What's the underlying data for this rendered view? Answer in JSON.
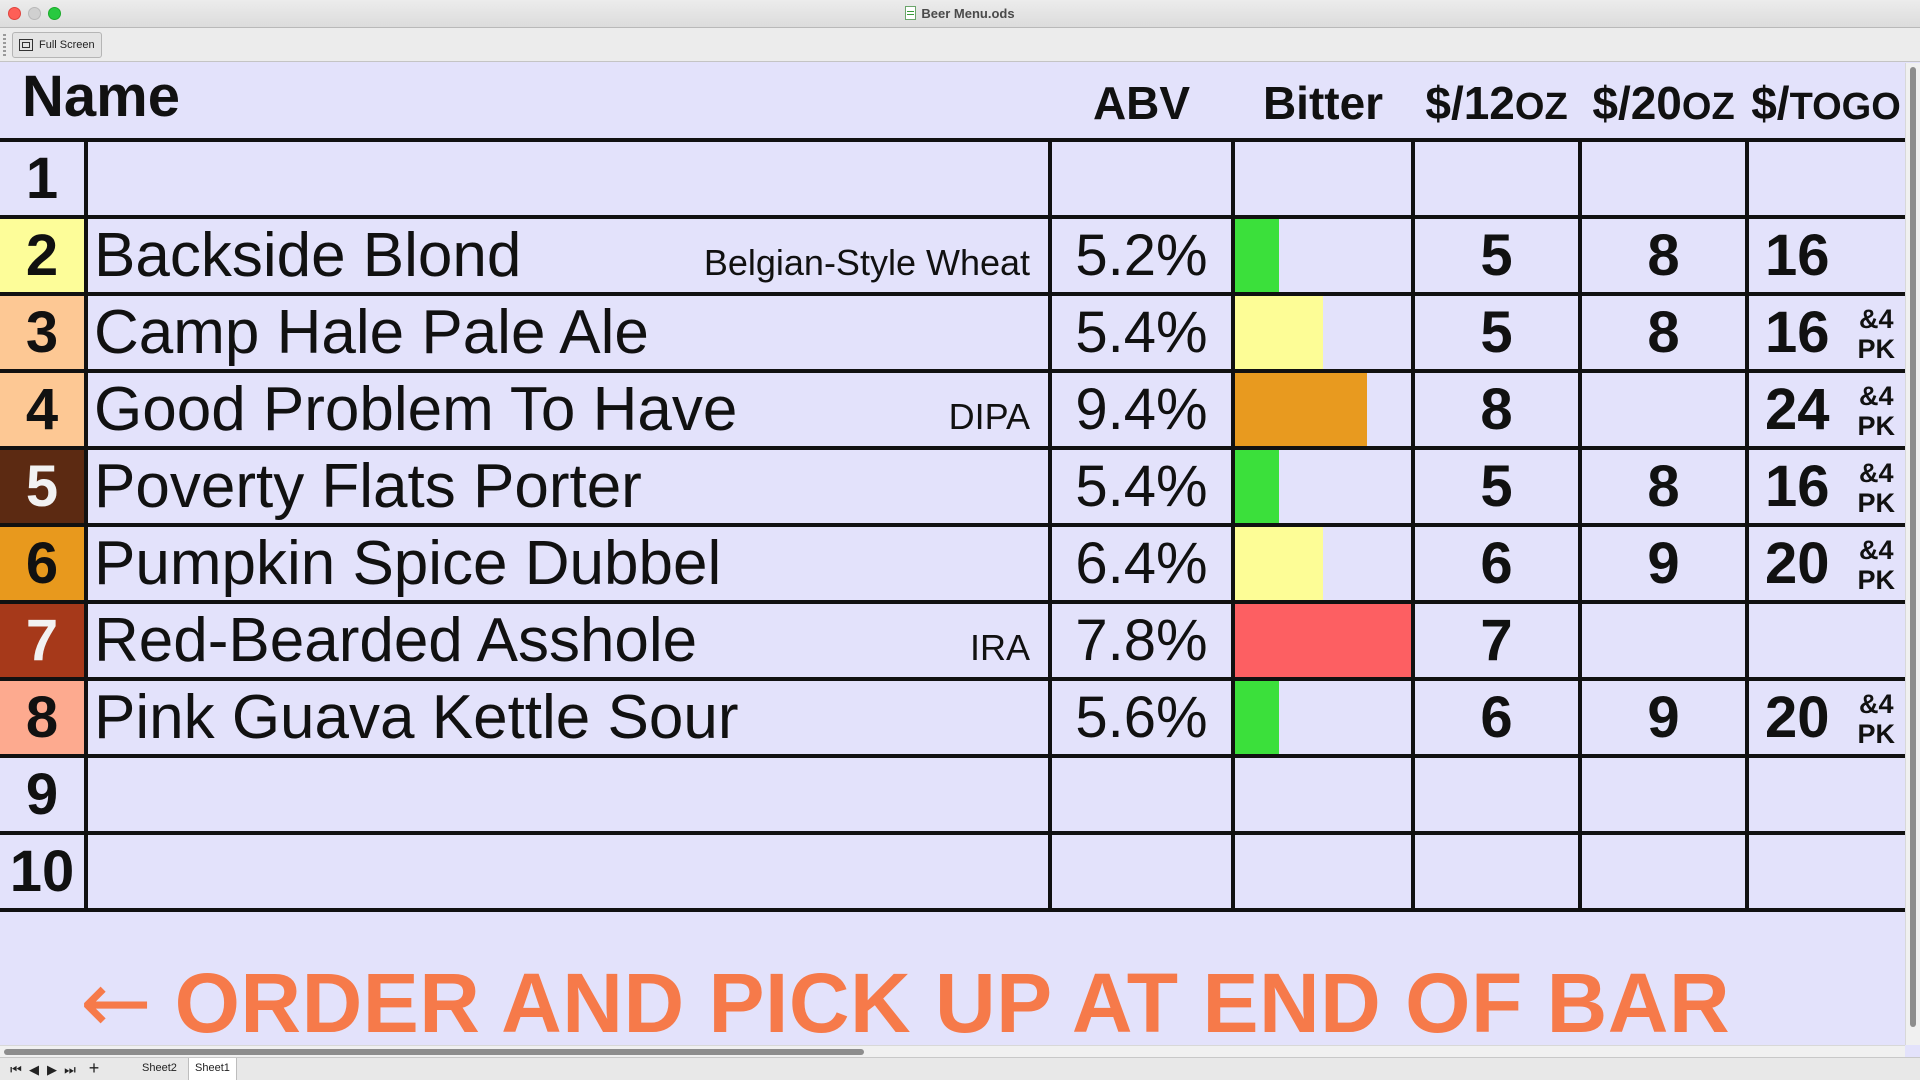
{
  "window": {
    "title": "Beer Menu.ods"
  },
  "toolbar": {
    "full_screen_label": "Full Screen"
  },
  "header": {
    "name": "Name",
    "abv": "ABV",
    "bitter": "Bitter",
    "p12_prefix": "$/12",
    "p12_unit": "OZ",
    "p20_prefix": "$/20",
    "p20_unit": "OZ",
    "togo_prefix": "$/",
    "togo_unit": "TOGO"
  },
  "rows": [
    {
      "num": "1",
      "num_bg": "#e3e2fb",
      "num_light": false,
      "name": "",
      "style": "",
      "abv": "",
      "bitter_level": 0,
      "bitter_color": "",
      "p12": "",
      "p20": "",
      "togo": "",
      "togo_note_1": "",
      "togo_note_2": ""
    },
    {
      "num": "2",
      "num_bg": "#fdfd99",
      "num_light": false,
      "name": "Backside Blond",
      "style": "Belgian-Style Wheat",
      "abv": "5.2%",
      "bitter_level": 0.25,
      "bitter_color": "#3be03b",
      "p12": "5",
      "p20": "8",
      "togo": "16",
      "togo_note_1": "",
      "togo_note_2": ""
    },
    {
      "num": "3",
      "num_bg": "#fdc894",
      "num_light": false,
      "name": "Camp Hale Pale Ale",
      "style": "",
      "abv": "5.4%",
      "bitter_level": 0.5,
      "bitter_color": "#fdfd96",
      "p12": "5",
      "p20": "8",
      "togo": "16",
      "togo_note_1": "&4",
      "togo_note_2": "PK"
    },
    {
      "num": "4",
      "num_bg": "#fdc894",
      "num_light": false,
      "name": "Good Problem To Have",
      "style": "DIPA",
      "abv": "9.4%",
      "bitter_level": 0.75,
      "bitter_color": "#e89a1f",
      "p12": "8",
      "p20": "",
      "togo": "24",
      "togo_note_1": "&4",
      "togo_note_2": "PK"
    },
    {
      "num": "5",
      "num_bg": "#5c2a12",
      "num_light": true,
      "name": "Poverty Flats Porter",
      "style": "",
      "abv": "5.4%",
      "bitter_level": 0.25,
      "bitter_color": "#3be03b",
      "p12": "5",
      "p20": "8",
      "togo": "16",
      "togo_note_1": "&4",
      "togo_note_2": "PK"
    },
    {
      "num": "6",
      "num_bg": "#e8991d",
      "num_light": false,
      "name": "Pumpkin Spice Dubbel",
      "style": "",
      "abv": "6.4%",
      "bitter_level": 0.5,
      "bitter_color": "#fdfd96",
      "p12": "6",
      "p20": "9",
      "togo": "20",
      "togo_note_1": "&4",
      "togo_note_2": "PK"
    },
    {
      "num": "7",
      "num_bg": "#a6391a",
      "num_light": true,
      "name": "Red-Bearded Asshole",
      "style": "IRA",
      "abv": "7.8%",
      "bitter_level": 1.0,
      "bitter_color": "#fd5f62",
      "p12": "7",
      "p20": "",
      "togo": "",
      "togo_note_1": "",
      "togo_note_2": ""
    },
    {
      "num": "8",
      "num_bg": "#fdaa8f",
      "num_light": false,
      "name": "Pink Guava Kettle Sour",
      "style": "",
      "abv": "5.6%",
      "bitter_level": 0.25,
      "bitter_color": "#3be03b",
      "p12": "6",
      "p20": "9",
      "togo": "20",
      "togo_note_1": "&4",
      "togo_note_2": "PK"
    },
    {
      "num": "9",
      "num_bg": "#e3e2fb",
      "num_light": false,
      "name": "",
      "style": "",
      "abv": "",
      "bitter_level": 0,
      "bitter_color": "",
      "p12": "",
      "p20": "",
      "togo": "",
      "togo_note_1": "",
      "togo_note_2": ""
    },
    {
      "num": "10",
      "num_bg": "#e3e2fb",
      "num_light": false,
      "name": "",
      "style": "",
      "abv": "",
      "bitter_level": 0,
      "bitter_color": "",
      "p12": "",
      "p20": "",
      "togo": "",
      "togo_note_1": "",
      "togo_note_2": ""
    }
  ],
  "footer": {
    "arrow": "←",
    "text": "ORDER AND PICK UP AT END OF BAR",
    "color": "#f67a4a"
  },
  "sheet_tabs": {
    "add": "+",
    "tab_1": "Sheet2",
    "tab_2": "Sheet1",
    "active": "Sheet1"
  }
}
